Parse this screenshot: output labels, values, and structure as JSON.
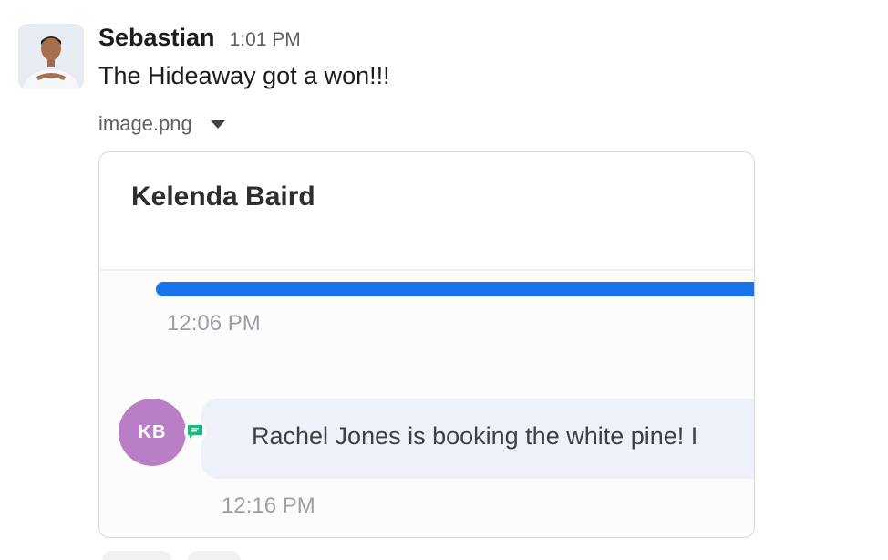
{
  "message": {
    "sender": "Sebastian",
    "timestamp": "1:01 PM",
    "text": "The Hideaway got a won!!!",
    "attachment": {
      "file_name": "image.png",
      "toggle_icon": "caret-down-icon"
    }
  },
  "preview": {
    "contact_name": "Kelenda Baird",
    "first_time": "12:06 PM",
    "avatar_initials": "KB",
    "badge_icon": "sms-chat-icon",
    "bubble_text": "Rachel Jones is booking the white pine! I",
    "second_time": "12:16 PM"
  },
  "colors": {
    "blue_bar": "#1a73e8",
    "kb_avatar": "#b97ec5",
    "badge": "#1fb87a",
    "bubble": "#eef1f9"
  }
}
